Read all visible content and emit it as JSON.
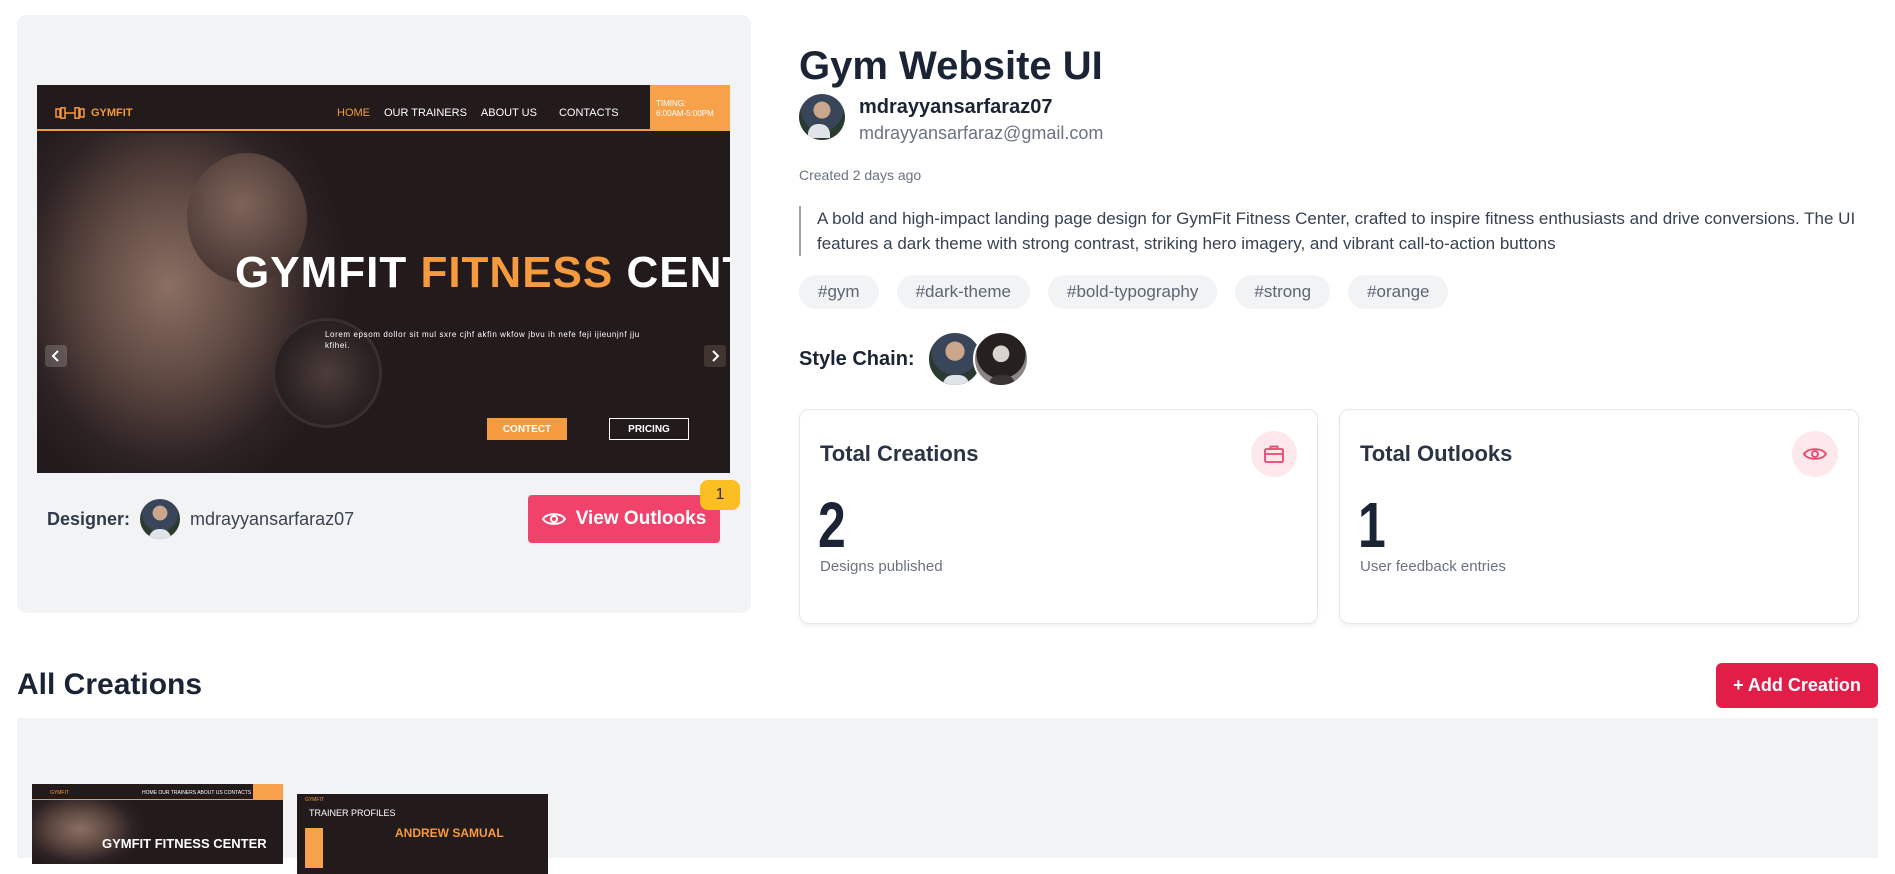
{
  "preview": {
    "mock": {
      "logo": "GYMFIT",
      "nav": [
        "HOME",
        "OUR TRAINERS",
        "ABOUT US",
        "CONTACTS"
      ],
      "timing": "TIMING:\n6:00AM-5:00PM",
      "title_part1": "GYMFIT ",
      "title_accent": "FITNESS",
      "title_part2": " CENTER",
      "lorem": "Lorem epsom dollor sit mul sxre cjhf akfin wkfow jbvu ih nefe feji ijieunjnf jju kfihei.",
      "contact_btn": "CONTECT",
      "pricing_btn": "PRICING"
    },
    "designer_label": "Designer:",
    "designer_name": "mdrayyansarfaraz07",
    "view_outlooks_label": "View Outlooks",
    "outlooks_badge": "1"
  },
  "info": {
    "title": "Gym Website UI",
    "author_name": "mdrayyansarfaraz07",
    "author_email": "mdrayyansarfaraz@gmail.com",
    "created": "Created 2 days ago",
    "description": "A bold and high-impact landing page design for GymFit Fitness Center, crafted to inspire fitness enthusiasts and drive conversions. The UI features a dark theme with strong contrast, striking hero imagery, and vibrant call-to-action buttons",
    "tags": [
      "#gym",
      "#dark-theme",
      "#bold-typography",
      "#strong",
      "#orange"
    ],
    "style_chain_label": "Style Chain:"
  },
  "stats": [
    {
      "title": "Total Creations",
      "value": "2",
      "sub": "Designs published",
      "icon": "briefcase-icon"
    },
    {
      "title": "Total Outlooks",
      "value": "1",
      "sub": "User feedback entries",
      "icon": "eye-icon"
    }
  ],
  "creations": {
    "title": "All Creations",
    "add_label": "+ Add Creation",
    "thumbs": [
      {
        "logo": "GYMFIT",
        "nav": "HOME   OUR TRAINERS   ABOUT US   CONTACTS",
        "hero": "GYMFIT FITNESS CENTER"
      },
      {
        "logo": "GYMFIT",
        "heading": "TRAINER PROFILES",
        "name": "ANDREW SAMUAL"
      }
    ]
  },
  "colors": {
    "accent": "#f0426a",
    "add_button": "#e11d48",
    "brand_orange": "#f59a3e",
    "badge": "#fbbf24"
  }
}
